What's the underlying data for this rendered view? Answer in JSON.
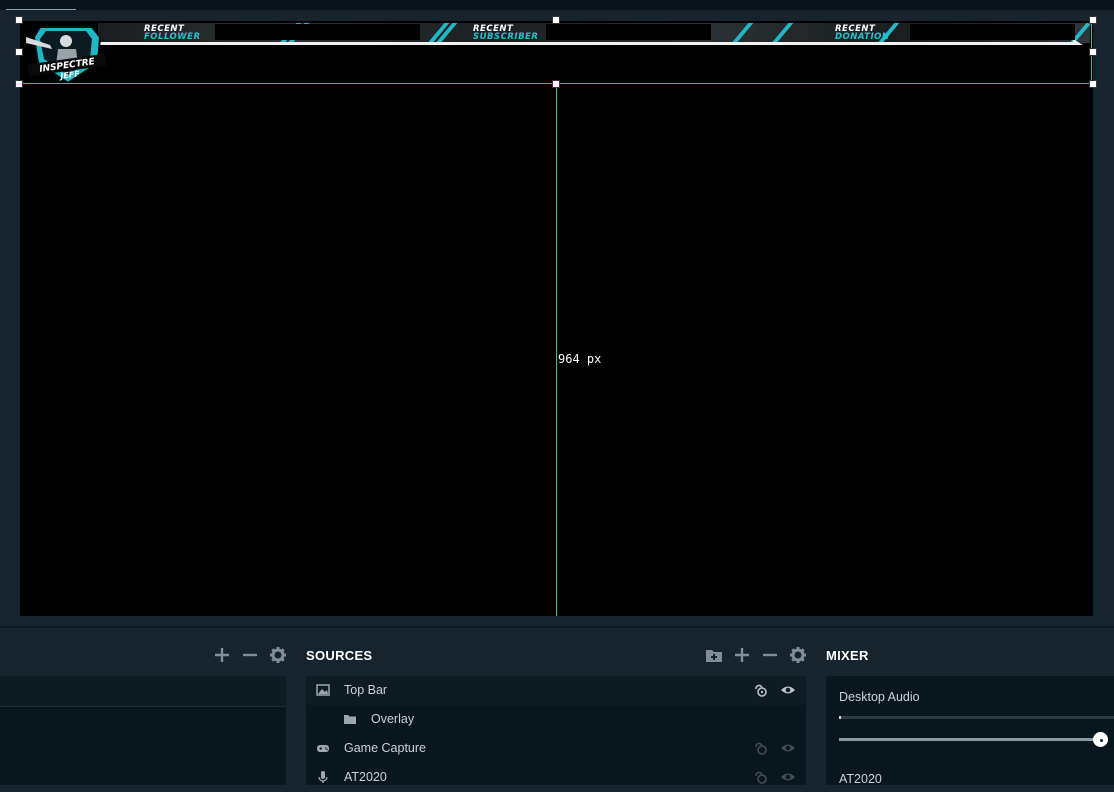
{
  "preview": {
    "overlay": {
      "labels": [
        {
          "top": "RECENT",
          "bottom": "FOLLOWER"
        },
        {
          "top": "RECENT",
          "bottom": "SUBSCRIBER"
        },
        {
          "top": "RECENT",
          "bottom": "DONATION"
        }
      ],
      "logo_text": [
        "INSPECTRE",
        "JEFF"
      ]
    },
    "guide_label": "964 px"
  },
  "dock": {
    "sources_title": "SOURCES",
    "mixer_title": "MIXER",
    "sources": [
      {
        "name": "Top Bar",
        "icon": "image-icon",
        "selected": true
      },
      {
        "name": "Overlay",
        "icon": "folder-icon",
        "selected": false
      },
      {
        "name": "Game Capture",
        "icon": "gamepad-icon",
        "selected": false
      },
      {
        "name": "AT2020",
        "icon": "microphone-icon",
        "selected": false
      }
    ],
    "mixer": {
      "channels": [
        {
          "name": "Desktop Audio",
          "volume_fraction": 1.0
        },
        {
          "name": "AT2020"
        }
      ]
    }
  },
  "colors": {
    "accent_cyan": "#23c3cf",
    "selection_green": "#31c3a3",
    "panel_bg": "#17242d",
    "list_bg": "#09161d"
  }
}
